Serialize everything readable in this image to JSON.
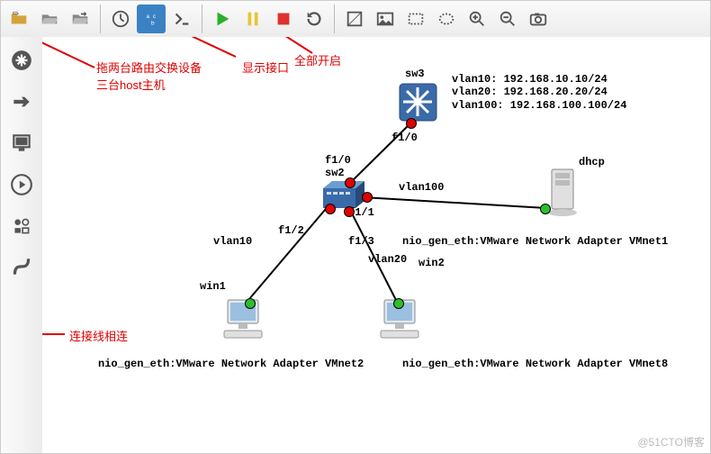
{
  "annotations": {
    "drag_line1": "拖两台路由交换设备",
    "drag_line2": "三台host主机",
    "show_interface": "显示接口",
    "start_all": "全部开启",
    "connect_lines": "连接线相连"
  },
  "topology": {
    "sw3": {
      "label": "sw3"
    },
    "sw2": {
      "label": "sw2"
    },
    "dhcp": {
      "label": "dhcp"
    },
    "win1": {
      "label": "win1"
    },
    "win2": {
      "label": "win2"
    },
    "ports": {
      "sw3_f10": "f1/0",
      "sw2_f10": "f1/0",
      "sw2_f11": "f1/1",
      "sw2_f12": "f1/2",
      "sw2_f13": "f1/3"
    },
    "vlan_labels": {
      "vlan100": "vlan100",
      "vlan10": "vlan10",
      "vlan20": "vlan20"
    },
    "host_nics": {
      "dhcp": "nio_gen_eth:VMware Network Adapter VMnet1",
      "win1": "nio_gen_eth:VMware Network Adapter VMnet2",
      "win2": "nio_gen_eth:VMware Network Adapter VMnet8"
    },
    "vlan_info": {
      "vlan10": "vlan10: 192.168.10.10/24",
      "vlan20": "vlan20: 192.168.20.20/24",
      "vlan100": "vlan100: 192.168.100.100/24"
    }
  },
  "watermark": "@51CTO博客"
}
